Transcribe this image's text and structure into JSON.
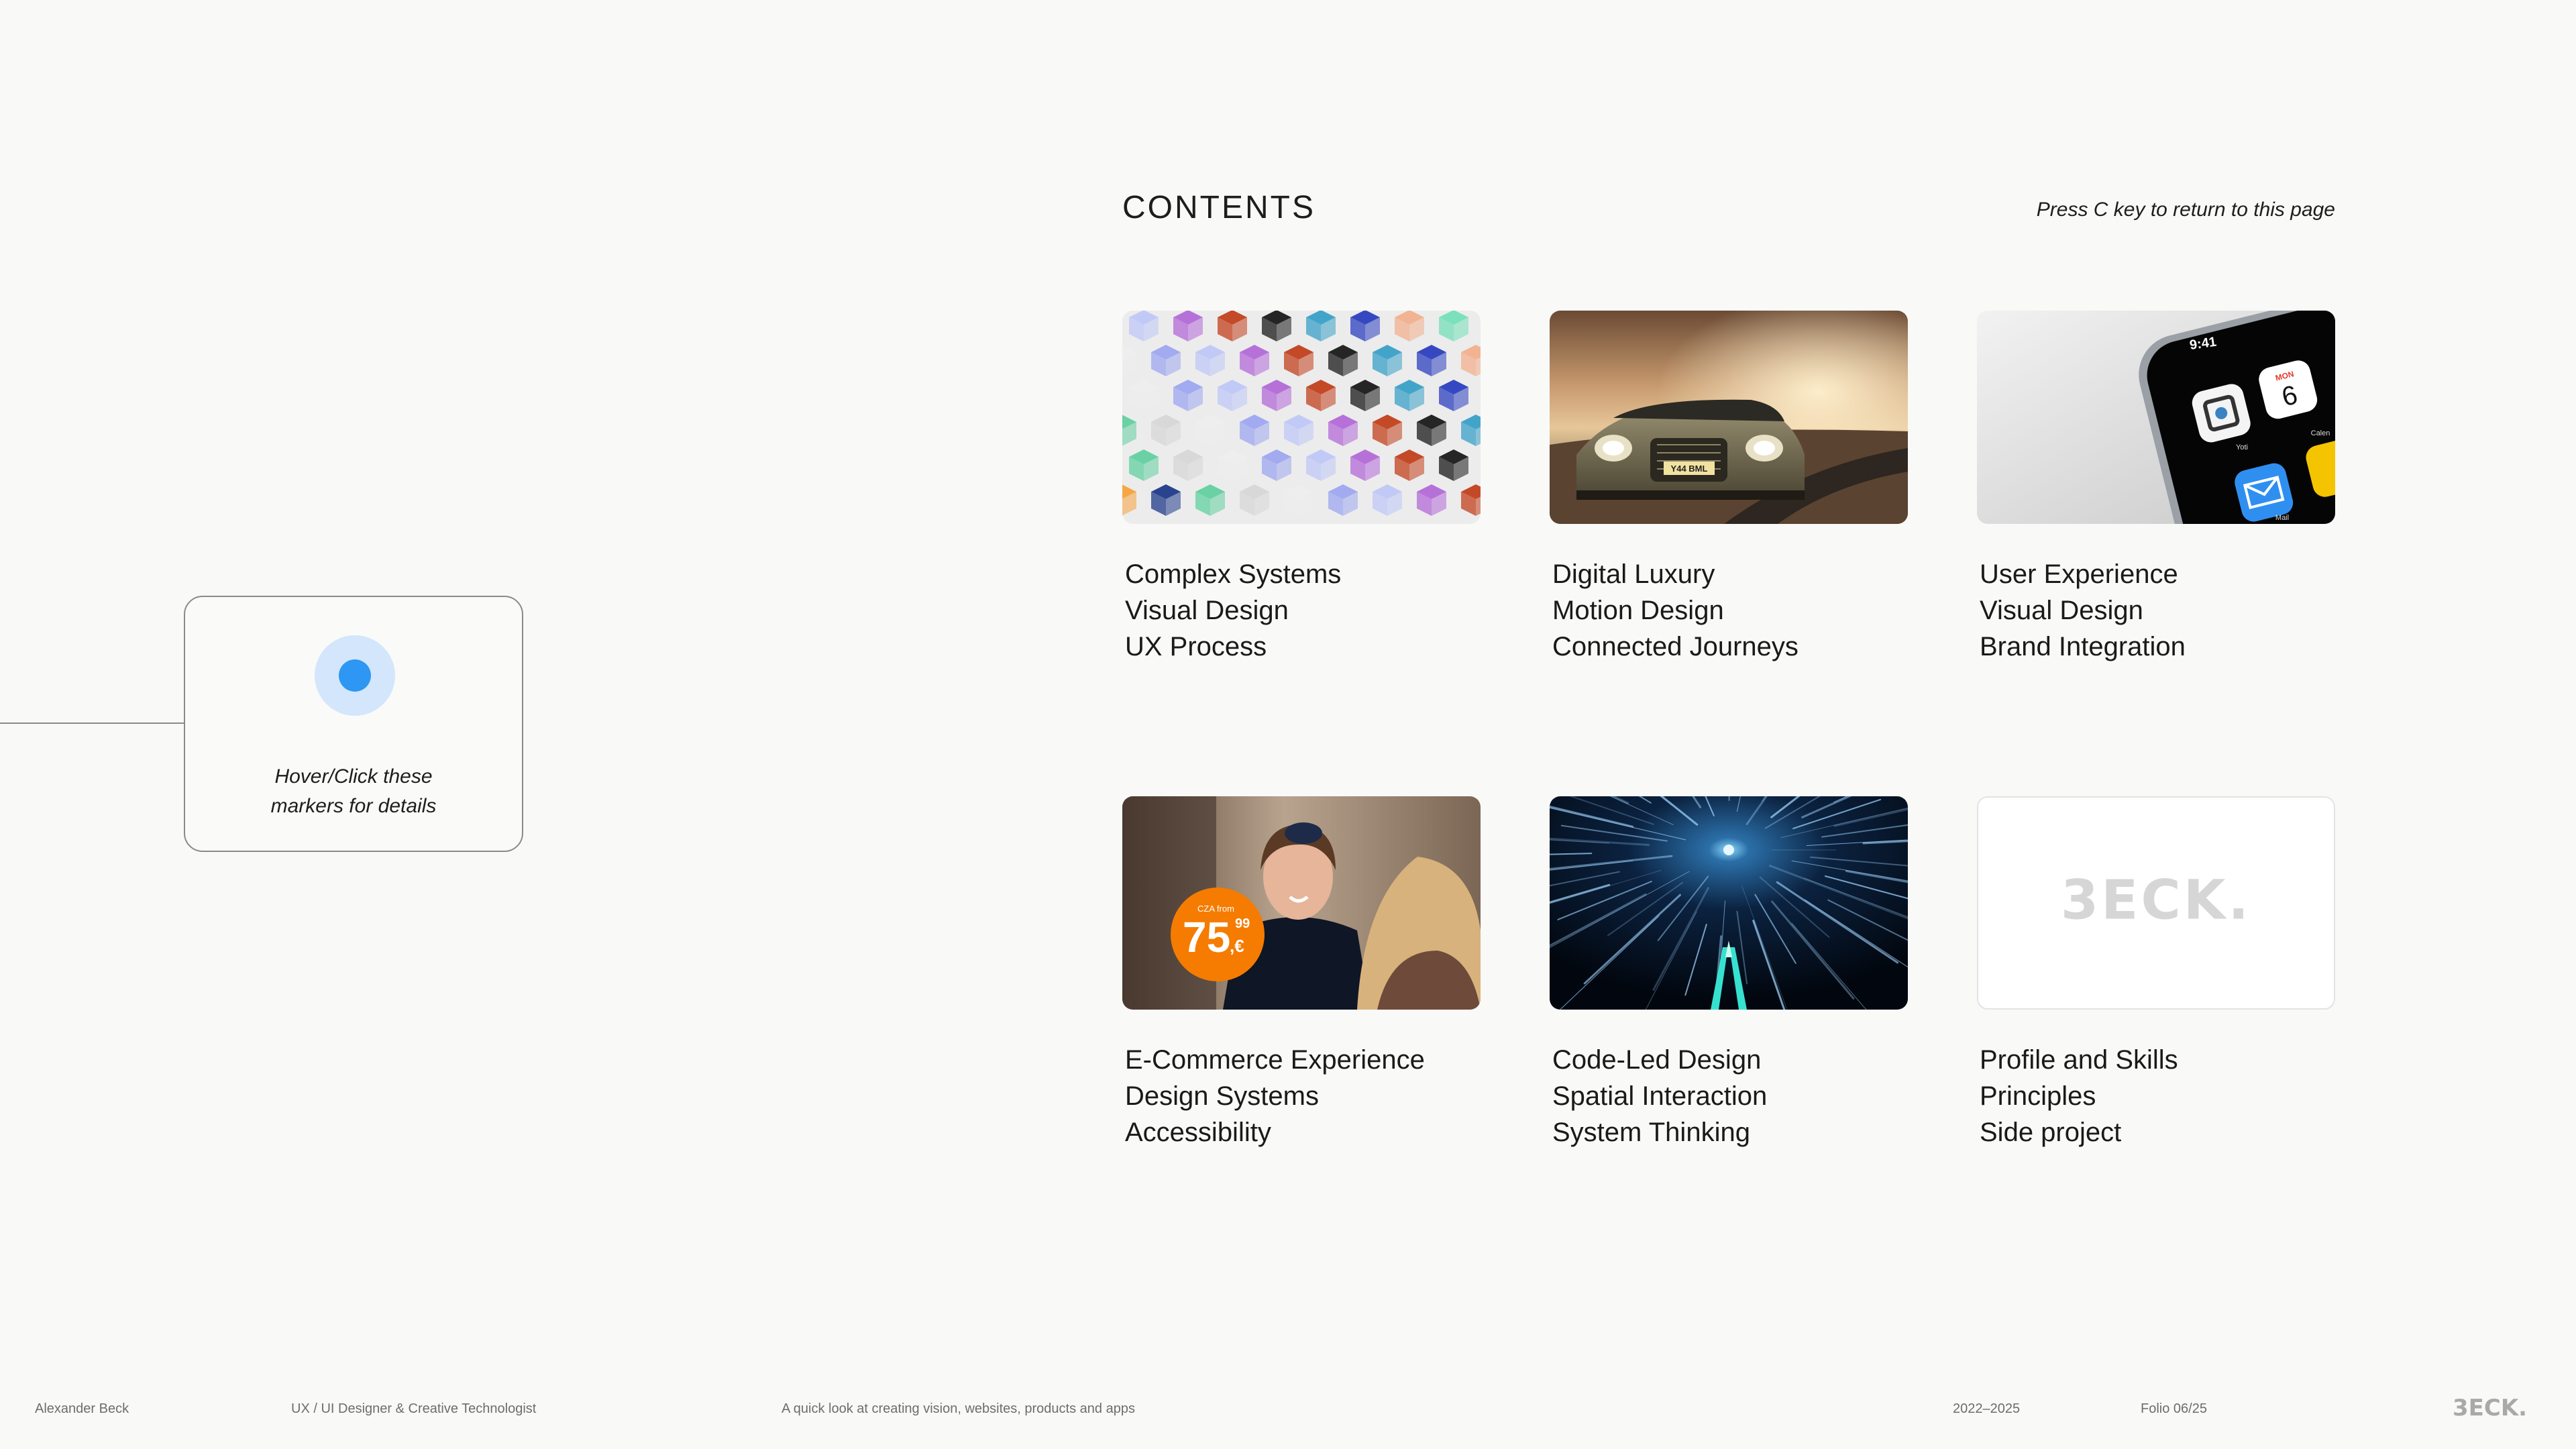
{
  "header": {
    "title": "CONTENTS",
    "hint": "Press C key to return to this page"
  },
  "projects": [
    {
      "thumb": "colorful-cube-keys-image",
      "tags": [
        "Complex Systems",
        "Visual Design",
        "UX Process"
      ]
    },
    {
      "thumb": "luxury-car-image",
      "tags": [
        "Digital Luxury",
        "Motion Design",
        "Connected Journeys"
      ],
      "plate": "Y44 BML"
    },
    {
      "thumb": "smartphone-homescreen-image",
      "tags": [
        "User Experience",
        "Visual Design",
        "Brand Integration"
      ],
      "phone": {
        "time": "9:41",
        "day": "MON",
        "date": "6",
        "app1": "Yoti",
        "app2": "Calen",
        "app3": "Mail"
      }
    },
    {
      "thumb": "airline-attendant-image",
      "tags": [
        "E-Commerce Experience",
        "Design Systems",
        "Accessibility"
      ],
      "price": {
        "prefix": "CZA from",
        "main": "75",
        "cents": "99",
        "currency": ",€"
      }
    },
    {
      "thumb": "light-speed-space-image",
      "tags": [
        "Code-Led Design",
        "Spatial Interaction",
        "System Thinking"
      ]
    },
    {
      "thumb": "beck-logo-image",
      "tags": [
        "Profile and Skills",
        "Principles",
        "Side project"
      ]
    }
  ],
  "callout": {
    "text_line1": "Hover/Click these",
    "text_line2": "markers for details",
    "marker_color": "#2d97f3"
  },
  "footer": {
    "name": "Alexander Beck",
    "role": "UX / UI Designer & Creative Technologist",
    "tagline": "A quick look at creating vision, websites, products and apps",
    "years": "2022–2025",
    "folio": "Folio 06/25",
    "logo": "3ECK."
  }
}
